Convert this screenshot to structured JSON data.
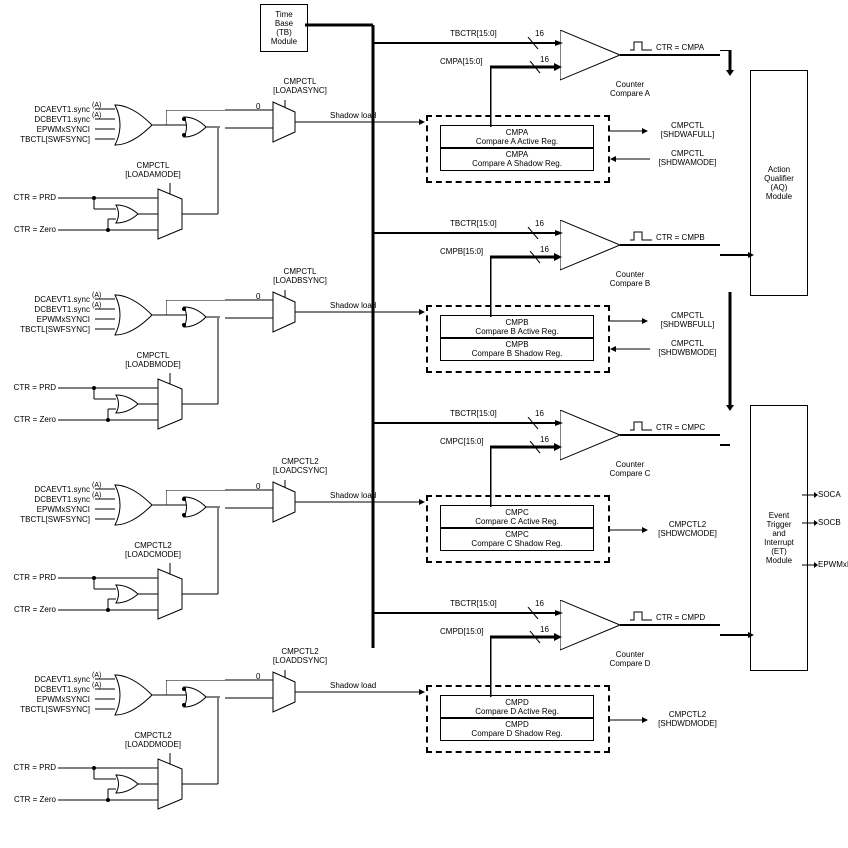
{
  "blocks": {
    "timebase": {
      "l1": "Time",
      "l2": "Base",
      "l3": "(TB)",
      "l4": "Module"
    },
    "aq": {
      "l1": "Action",
      "l2": "Qualifier",
      "l3": "(AQ)",
      "l4": "Module"
    },
    "et": {
      "l1": "Event",
      "l2": "Trigger",
      "l3": "and",
      "l4": "Interrupt",
      "l5": "(ET)",
      "l6": "Module"
    }
  },
  "sections": [
    {
      "id": "A",
      "sync": {
        "l1": "CMPCTL",
        "l2": "[LOADASYNC]"
      },
      "mode": {
        "l1": "CMPCTL",
        "l2": "[LOADAMODE]"
      },
      "tbctr": "TBCTR[15:0]",
      "cmp": "CMPA[15:0]",
      "cc": {
        "l1": "Counter",
        "l2": "Compare A"
      },
      "ctr": "CTR = CMPA",
      "reg": {
        "a1": "CMPA",
        "a2": "Compare A Active Reg.",
        "s1": "CMPA",
        "s2": "Compare A Shadow Reg."
      },
      "status1": {
        "l1": "CMPCTL",
        "l2": "[SHDWAFULL]"
      },
      "status2": {
        "l1": "CMPCTL",
        "l2": "[SHDWAMODE]"
      }
    },
    {
      "id": "B",
      "sync": {
        "l1": "CMPCTL",
        "l2": "[LOADBSYNC]"
      },
      "mode": {
        "l1": "CMPCTL",
        "l2": "[LOADBMODE]"
      },
      "tbctr": "TBCTR[15:0]",
      "cmp": "CMPB[15:0]",
      "cc": {
        "l1": "Counter",
        "l2": "Compare B"
      },
      "ctr": "CTR = CMPB",
      "reg": {
        "a1": "CMPB",
        "a2": "Compare B Active Reg.",
        "s1": "CMPB",
        "s2": "Compare B Shadow Reg."
      },
      "status1": {
        "l1": "CMPCTL",
        "l2": "[SHDWBFULL]"
      },
      "status2": {
        "l1": "CMPCTL",
        "l2": "[SHDWBMODE]"
      }
    },
    {
      "id": "C",
      "sync": {
        "l1": "CMPCTL2",
        "l2": "[LOADCSYNC]"
      },
      "mode": {
        "l1": "CMPCTL2",
        "l2": "[LOADCMODE]"
      },
      "tbctr": "TBCTR[15:0]",
      "cmp": "CMPC[15:0]",
      "cc": {
        "l1": "Counter",
        "l2": "Compare C"
      },
      "ctr": "CTR = CMPC",
      "reg": {
        "a1": "CMPC",
        "a2": "Compare C Active Reg.",
        "s1": "CMPC",
        "s2": "Compare C Shadow Reg."
      },
      "status1": {
        "l1": "CMPCTL2",
        "l2": "[SHDWCMODE]"
      },
      "status2": null
    },
    {
      "id": "D",
      "sync": {
        "l1": "CMPCTL2",
        "l2": "[LOADDSYNC]"
      },
      "mode": {
        "l1": "CMPCTL2",
        "l2": "[LOADDMODE]"
      },
      "tbctr": "TBCTR[15:0]",
      "cmp": "CMPD[15:0]",
      "cc": {
        "l1": "Counter",
        "l2": "Compare D"
      },
      "ctr": "CTR = CMPD",
      "reg": {
        "a1": "CMPD",
        "a2": "Compare D Active Reg.",
        "s1": "CMPD",
        "s2": "Compare D Shadow Reg."
      },
      "status1": {
        "l1": "CMPCTL2",
        "l2": "[SHDWDMODE]"
      },
      "status2": null
    }
  ],
  "sigs": {
    "dca": "DCAEVT1.sync",
    "dcb": "DCBEVT1.sync",
    "epwm": "EPWMxSYNCI",
    "tbctl": "TBCTL[SWFSYNC]",
    "prd": "CTR = PRD",
    "zero": "CTR = Zero",
    "shadow": "Shadow load",
    "sup": "(A)",
    "zero_num": "0",
    "sixteen": "16"
  },
  "outputs": {
    "soca": "SOCA",
    "socb": "SOCB",
    "epwmint": "EPWMxINT"
  }
}
